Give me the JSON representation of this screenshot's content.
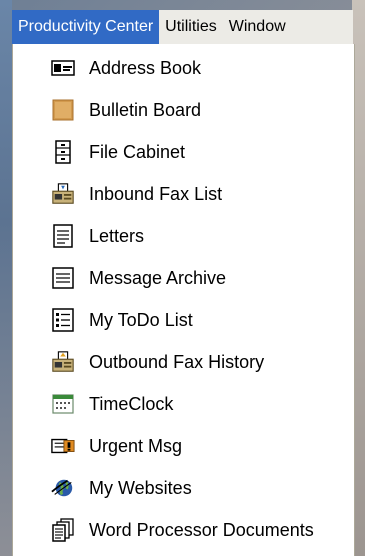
{
  "menubar": {
    "items": [
      {
        "label": "Productivity Center",
        "active": true
      },
      {
        "label": "Utilities",
        "active": false
      },
      {
        "label": "Window",
        "active": false
      }
    ]
  },
  "dropdown": {
    "items": [
      {
        "label": "Address Book",
        "icon": "address-book-icon"
      },
      {
        "label": "Bulletin Board",
        "icon": "bulletin-board-icon"
      },
      {
        "label": "File Cabinet",
        "icon": "file-cabinet-icon"
      },
      {
        "label": "Inbound Fax List",
        "icon": "inbound-fax-icon"
      },
      {
        "label": "Letters",
        "icon": "letters-icon"
      },
      {
        "label": "Message Archive",
        "icon": "message-archive-icon"
      },
      {
        "label": "My ToDo List",
        "icon": "todo-list-icon"
      },
      {
        "label": "Outbound Fax History",
        "icon": "outbound-fax-icon"
      },
      {
        "label": "TimeClock",
        "icon": "timeclock-icon"
      },
      {
        "label": "Urgent Msg",
        "icon": "urgent-msg-icon"
      },
      {
        "label": "My Websites",
        "icon": "globe-icon"
      },
      {
        "label": "Word Processor Documents",
        "icon": "word-processor-icon"
      }
    ]
  },
  "colors": {
    "menu_highlight": "#316ac5",
    "menu_bg": "#ecebe6",
    "dropdown_bg": "#ffffff"
  }
}
